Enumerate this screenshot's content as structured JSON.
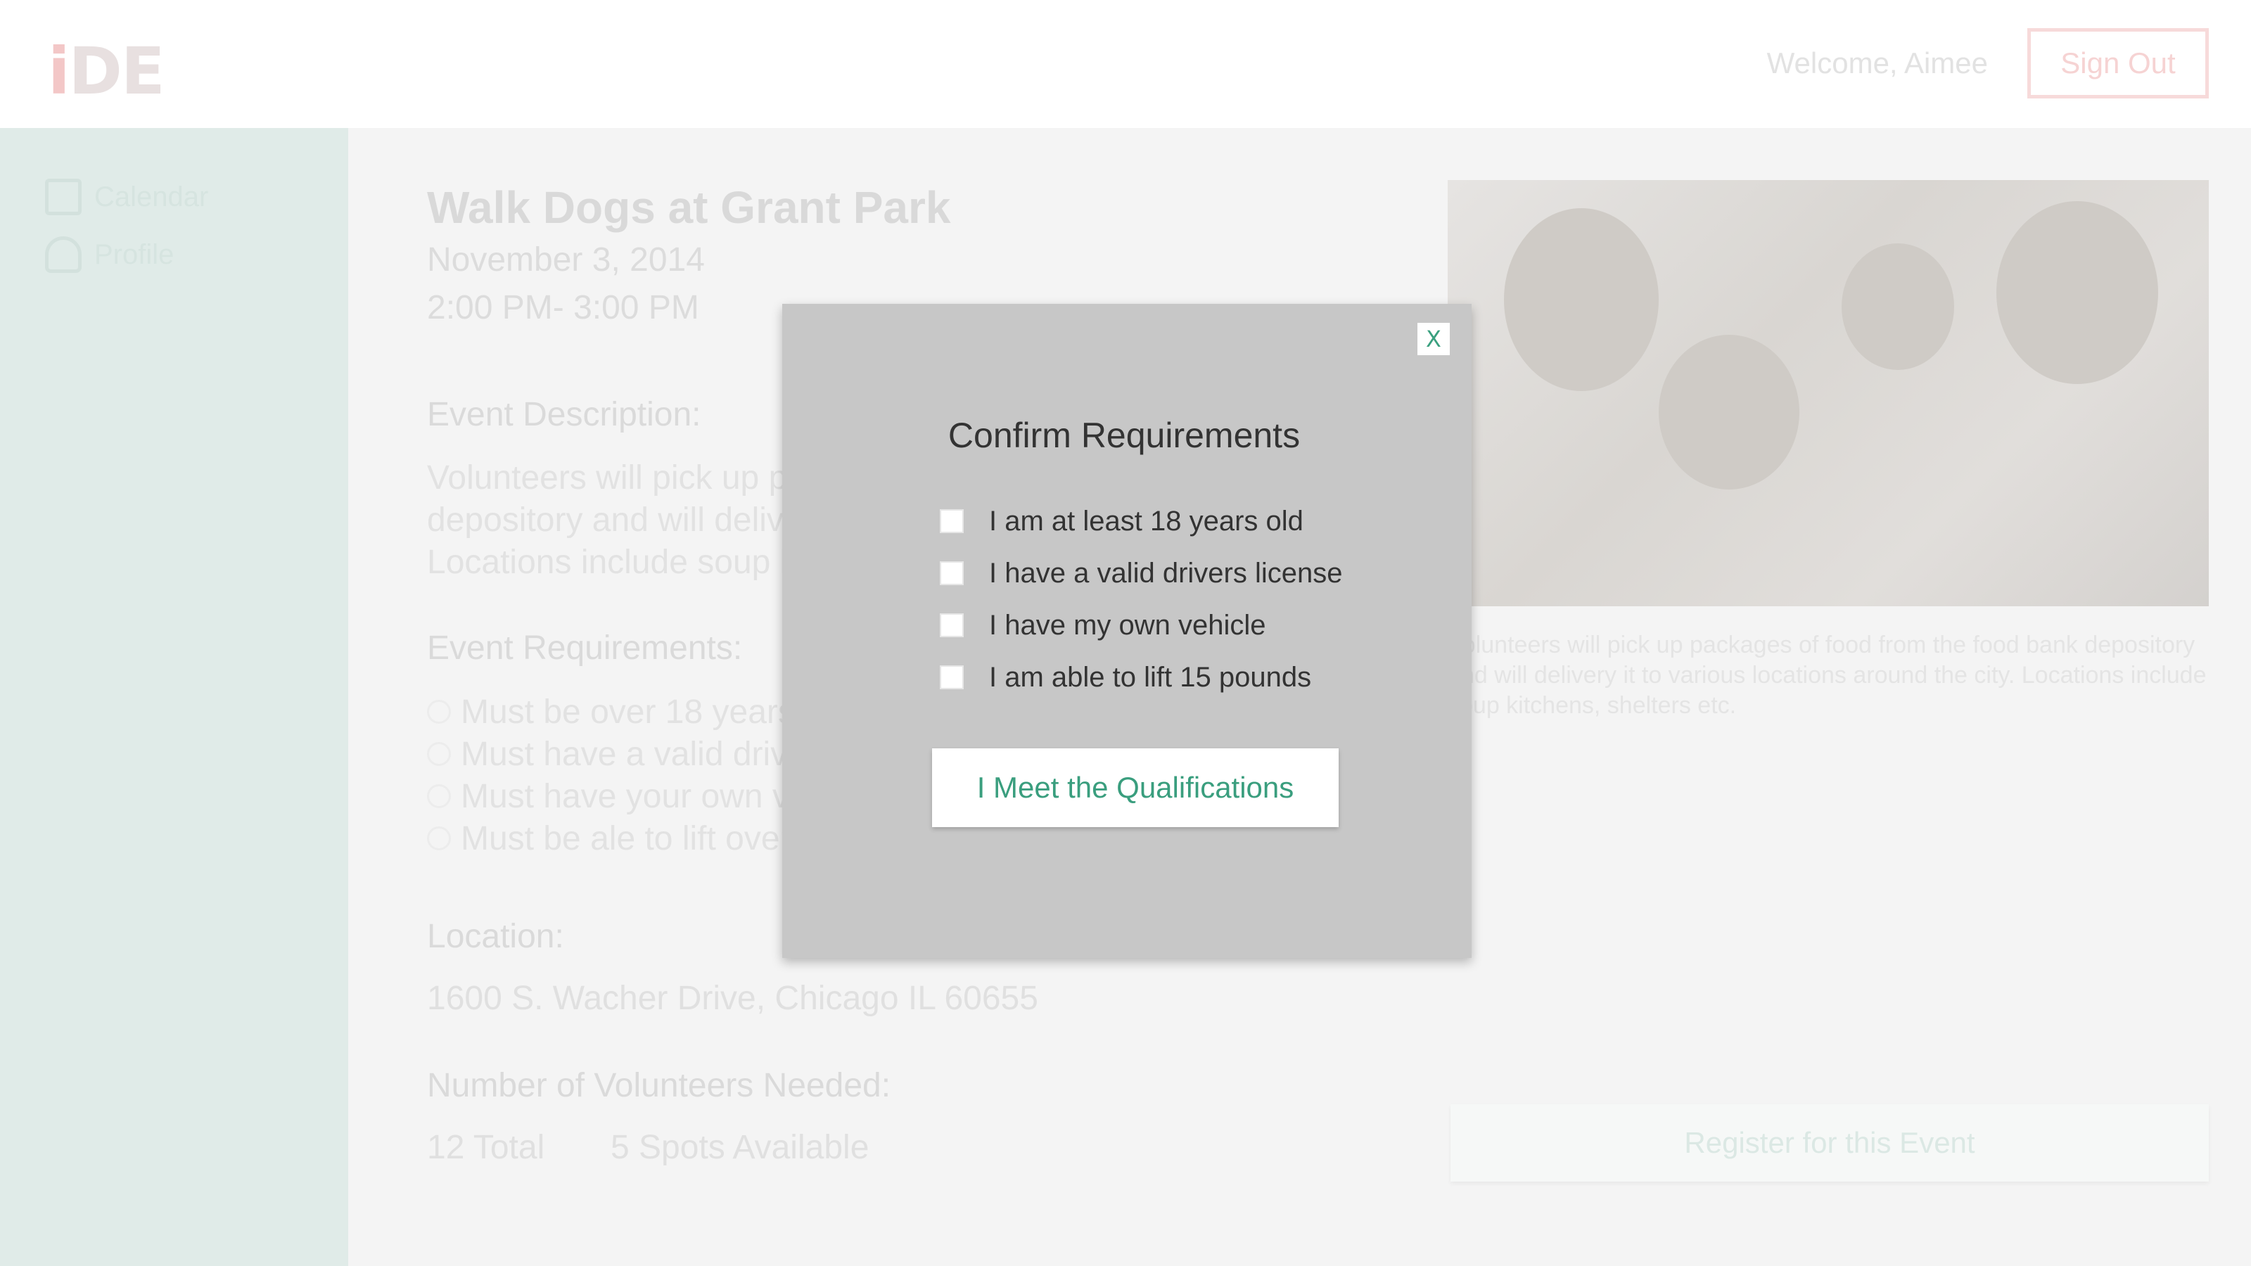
{
  "header": {
    "logo": "iDE",
    "welcome": "Welcome, Aimee",
    "signout_label": "Sign Out"
  },
  "sidebar": {
    "items": [
      {
        "label": "Calendar",
        "icon": "calendar-icon"
      },
      {
        "label": "Profile",
        "icon": "person-icon"
      }
    ]
  },
  "event": {
    "title": "Walk Dogs at Grant Park",
    "date": "November 3, 2014",
    "time": "2:00 PM- 3:00 PM",
    "description_heading": "Event Description:",
    "description": "Volunteers will pick up packages of food from the food bank depository and will delivery it to various locations around the city. Locations include soup kitchens, shelters etc.",
    "requirements_heading": "Event Requirements:",
    "requirements": [
      "Must be over 18 years old",
      "Must have a valid drivers license",
      "Must have your own vehicle",
      "Must be ale to lift over 15 pounds"
    ],
    "location_heading": "Location:",
    "location": "1600 S. Wacher Drive, Chicago IL 60655",
    "volunteers_heading": "Number of Volunteers Needed:",
    "volunteers_total": "12 Total",
    "volunteers_available": "5 Spots Available",
    "caption": "Volunteers will pick up packages of food from the food bank depository and will delivery it to various locations around the city. Locations include soup kitchens, shelters etc.",
    "register_label": "Register for this Event"
  },
  "modal": {
    "close_label": "X",
    "title": "Confirm Requirements",
    "checks": [
      {
        "label": "I am at least 18 years old",
        "checked": false
      },
      {
        "label": "I have a valid drivers license",
        "checked": false
      },
      {
        "label": "I have my own vehicle",
        "checked": false
      },
      {
        "label": "I am able to lift 15 pounds",
        "checked": false
      }
    ],
    "confirm_label": "I Meet the Qualifications"
  },
  "colors": {
    "accent": "#3a9e7e",
    "brand": "#f3c7c7",
    "sidebar": "#e0ebe8",
    "modal_bg": "#c7c7c7"
  }
}
